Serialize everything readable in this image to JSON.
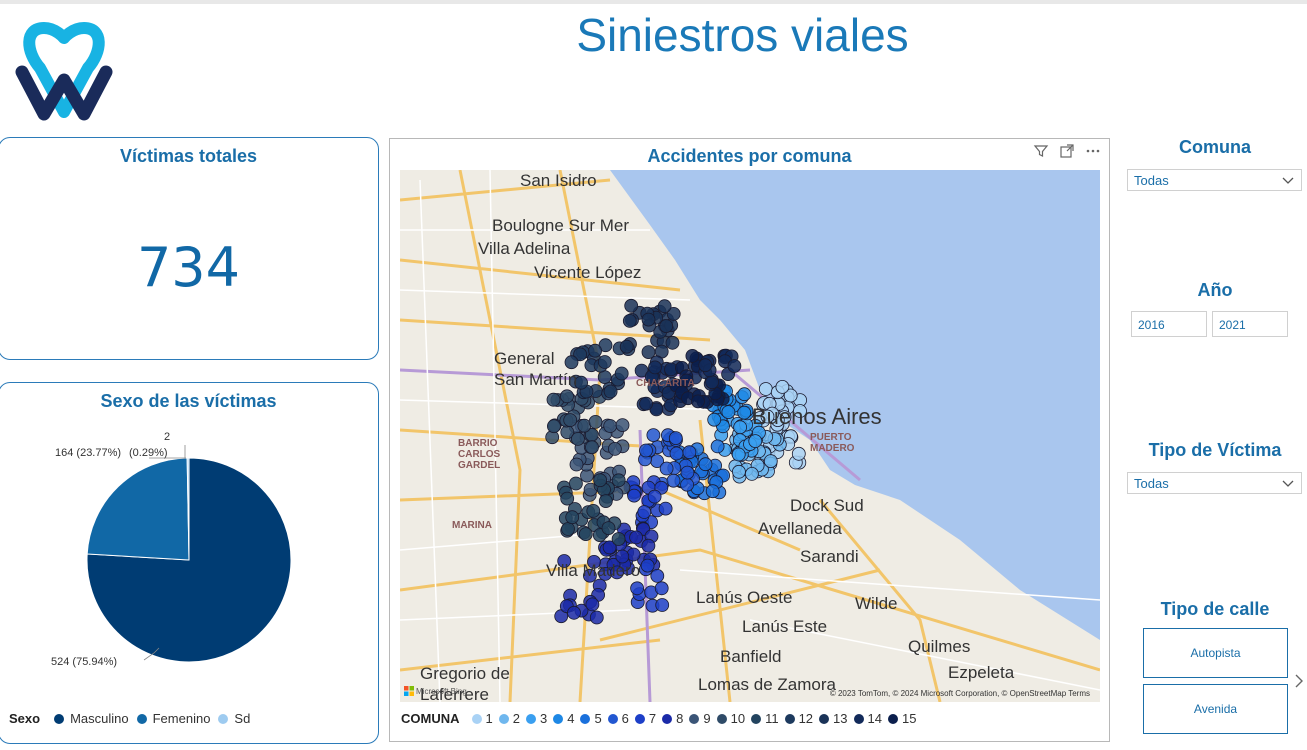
{
  "header": {
    "title": "Siniestros viales",
    "logo": "logo-icon"
  },
  "kpi": {
    "title": "Víctimas totales",
    "value": "734"
  },
  "sex_chart": {
    "title": "Sexo de las víctimas",
    "legend_title": "Sexo",
    "chart_data": {
      "type": "pie",
      "title": "Sexo de las víctimas",
      "labels": [
        "Masculino",
        "Femenino",
        "Sd"
      ],
      "values": [
        524,
        164,
        2
      ],
      "percent_labels": [
        "524 (75.94%)",
        "164 (23.77%)",
        "2 (0.29%)"
      ],
      "colors": [
        "#003c73",
        "#1168a6",
        "#9ecbf0"
      ],
      "legend": "bottom-left"
    },
    "label_masculino": "524 (75.94%)",
    "label_femenino": "164 (23.77%)",
    "label_sd_count": "2",
    "label_sd_pct": "(0.29%)",
    "legend_items": [
      "Masculino",
      "Femenino",
      "Sd"
    ]
  },
  "map": {
    "title": "Accidentes por comuna",
    "legend_title": "COMUNA",
    "legend_items": [
      "1",
      "2",
      "3",
      "4",
      "5",
      "6",
      "7",
      "8",
      "9",
      "10",
      "11",
      "12",
      "13",
      "14",
      "15"
    ],
    "legend_colors": [
      "#a9d2f5",
      "#6fb7ee",
      "#3a9ff0",
      "#1e88e5",
      "#1a70dc",
      "#2257d1",
      "#1d3fc8",
      "#1b2aa8",
      "#3b5577",
      "#2f4b68",
      "#23445f",
      "#1d3a5e",
      "#1a3358",
      "#122a5a",
      "#0b1f4d"
    ],
    "labels": [
      "San Isidro",
      "Boulogne Sur Mer",
      "Villa Adelina",
      "Vicente López",
      "General San Martín",
      "Buenos Aires",
      "Dock Sud",
      "Avellaneda",
      "Sarandi",
      "Villa Madero",
      "Lanús Oeste",
      "Lanús Este",
      "Wilde",
      "Banfield",
      "Quilmes",
      "Ezpeleta",
      "Gregorio de Laferrere",
      "Lomas de Zamora",
      "BARRIO CARLOS GARDEL",
      "MARINA",
      "PUERTO MADERO",
      "CHACARITA"
    ],
    "attribution": "© 2023 TomTom, © 2024 Microsoft Corporation, © OpenStreetMap  Terms",
    "provider": "Microsoft Bing",
    "icons": [
      "filter-icon",
      "focus-mode-icon",
      "more-options-icon"
    ]
  },
  "filters": {
    "comuna": {
      "title": "Comuna",
      "value": "Todas"
    },
    "anio": {
      "title": "Año",
      "from": "2016",
      "to": "2021"
    },
    "tipo_victima": {
      "title": "Tipo de Víctima",
      "value": "Todas"
    },
    "tipo_calle": {
      "title": "Tipo de calle",
      "options": [
        "Autopista",
        "Avenida"
      ]
    }
  },
  "colors": {
    "accent": "#1a79b8",
    "card_border": "#2b7bb9",
    "water": "#a9c6ee"
  }
}
